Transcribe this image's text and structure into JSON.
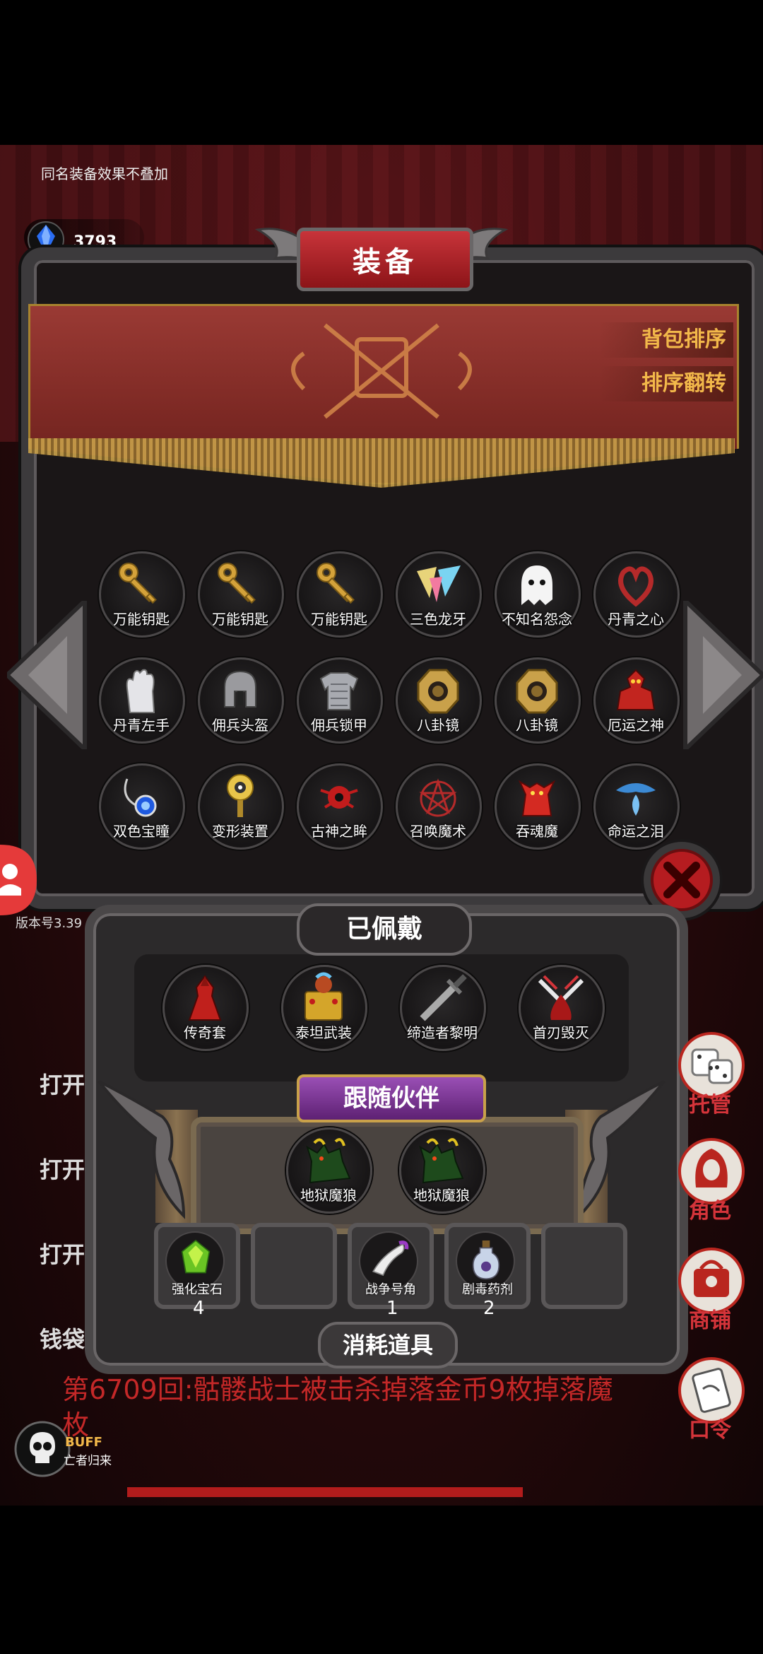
{
  "hint": "同名装备效果不叠加",
  "gems": {
    "count": "3793",
    "label": "宝石"
  },
  "title": "装备",
  "sort_buttons": [
    "背包排序",
    "排序翻转"
  ],
  "grid_items": [
    {
      "label": "万能钥匙",
      "icon": "key-icon"
    },
    {
      "label": "万能钥匙",
      "icon": "key-icon"
    },
    {
      "label": "万能钥匙",
      "icon": "key-icon"
    },
    {
      "label": "三色龙牙",
      "icon": "dragon-fang-icon"
    },
    {
      "label": "不知名怨念",
      "icon": "ghost-icon"
    },
    {
      "label": "丹青之心",
      "icon": "heart-icon"
    },
    {
      "label": "丹青左手",
      "icon": "glove-icon"
    },
    {
      "label": "佣兵头盔",
      "icon": "helmet-icon"
    },
    {
      "label": "佣兵锁甲",
      "icon": "armor-icon"
    },
    {
      "label": "八卦镜",
      "icon": "bagua-mirror-icon"
    },
    {
      "label": "八卦镜",
      "icon": "bagua-mirror-icon"
    },
    {
      "label": "厄运之神",
      "icon": "demon-icon"
    },
    {
      "label": "双色宝瞳",
      "icon": "amulet-icon"
    },
    {
      "label": "变形装置",
      "icon": "device-icon"
    },
    {
      "label": "古神之眸",
      "icon": "eye-icon"
    },
    {
      "label": "召唤魔术",
      "icon": "pentagram-icon"
    },
    {
      "label": "吞魂魔",
      "icon": "red-demon-icon"
    },
    {
      "label": "命运之泪",
      "icon": "tear-icon"
    }
  ],
  "version": "版本号3.39",
  "log_lines": [
    "打开",
    "打开",
    "打开",
    "钱袋"
  ],
  "log_red": "第6709回:骷髅战士被击杀掉落金币9枚掉落魔",
  "log_red2": "枚",
  "equipped": {
    "title": "已佩戴",
    "items": [
      {
        "label": "传奇套",
        "icon": "robe-icon"
      },
      {
        "label": "泰坦武装",
        "icon": "titan-armor-icon"
      },
      {
        "label": "缔造者黎明",
        "icon": "sword-icon"
      },
      {
        "label": "首刃毁灭",
        "icon": "blade-icon"
      }
    ]
  },
  "partners": {
    "title": "跟随伙伴",
    "items": [
      {
        "label": "地狱魔狼",
        "icon": "hellwolf-icon"
      },
      {
        "label": "地狱魔狼",
        "icon": "hellwolf-icon"
      }
    ]
  },
  "consumables": {
    "title": "消耗道具",
    "items": [
      {
        "label": "强化宝石",
        "count": "4",
        "icon": "green-gem-icon"
      },
      {
        "label": "",
        "count": "",
        "icon": ""
      },
      {
        "label": "战争号角",
        "count": "1",
        "icon": "horn-icon"
      },
      {
        "label": "剧毒药剂",
        "count": "2",
        "icon": "potion-icon"
      },
      {
        "label": "",
        "count": "",
        "icon": ""
      }
    ]
  },
  "right_menu": [
    "托管",
    "角色",
    "商铺",
    "口令"
  ],
  "buff": {
    "label": "BUFF",
    "sub": "亡者归来"
  }
}
